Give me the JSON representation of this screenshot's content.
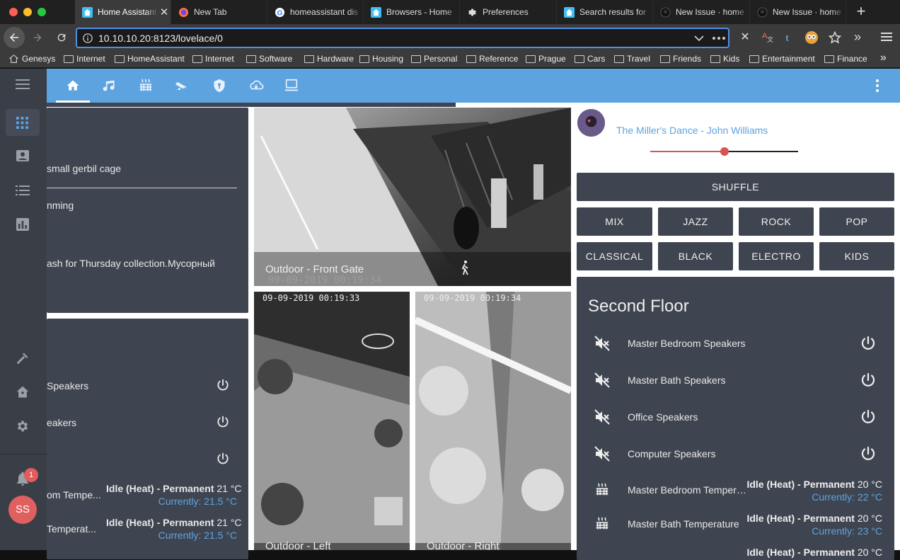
{
  "browser": {
    "tabs": [
      {
        "title": "Home Assistant",
        "icon": "home-assistant-icon",
        "active": true
      },
      {
        "title": "New Tab",
        "icon": "firefox-icon"
      },
      {
        "title": "homeassistant dis",
        "icon": "google-icon"
      },
      {
        "title": "Browsers - Home",
        "icon": "home-assistant-icon"
      },
      {
        "title": "Preferences",
        "icon": "gear-icon"
      },
      {
        "title": "Search results for",
        "icon": "home-assistant-icon"
      },
      {
        "title": "New Issue · home",
        "icon": "github-icon"
      },
      {
        "title": "New Issue · home",
        "icon": "github-icon"
      }
    ],
    "url": "10.10.10.20:8123/lovelace/0",
    "bookmarks": [
      "Genesys",
      "Internet",
      "HomeAssistant",
      "Internet",
      "Software",
      "Hardware",
      "Housing",
      "Personal",
      "Reference",
      "Prague",
      "Cars",
      "Travel",
      "Friends",
      "Kids",
      "Entertainment",
      "Finance"
    ]
  },
  "sidebar": {
    "notification_count": "1",
    "avatar_initials": "SS"
  },
  "left_card1": {
    "items": [
      "small gerbil cage",
      "nming",
      "ash for Thursday collection.Мусорный"
    ]
  },
  "left_card2": {
    "speakers": [
      " Speakers",
      "eakers",
      ""
    ],
    "thermostats": [
      {
        "name": "om Tempe...",
        "state": "Idle (Heat) - Permanent",
        "target": "21 °C",
        "current": "Currently: 21.5 °C"
      },
      {
        "name": " Temperat...",
        "state": "Idle (Heat) - Permanent",
        "target": "21 °C",
        "current": "Currently: 21.5 °C"
      }
    ]
  },
  "cameras": {
    "front": {
      "label": "Outdoor - Front Gate",
      "timestamp": "09-09-2019 00:19:34"
    },
    "left": {
      "label": "Outdoor - Left",
      "timestamp": "09-09-2019 00:19:33"
    },
    "right": {
      "label": "Outdoor - Right",
      "timestamp": "09-09-2019 00:19:34"
    }
  },
  "media": {
    "track": "The Miller's Dance - John Williams",
    "volume": 0.5
  },
  "music_buttons": {
    "shuffle": "SHUFFLE",
    "genres": [
      "MIX",
      "JAZZ",
      "ROCK",
      "POP",
      "CLASSICAL",
      "BLACK",
      "ELECTRO",
      "KIDS"
    ]
  },
  "second_floor": {
    "title": "Second Floor",
    "speakers": [
      "Master Bedroom Speakers",
      "Master Bath Speakers",
      "Office Speakers",
      "Computer Speakers"
    ],
    "thermostats": [
      {
        "name": "Master Bedroom Temperature",
        "state": "Idle (Heat) - Permanent",
        "target": "20 °C",
        "current": "Currently: 22 °C"
      },
      {
        "name": "Master Bath Temperature",
        "state": "Idle (Heat) - Permanent",
        "target": "20 °C",
        "current": "Currently: 23 °C"
      },
      {
        "name": "",
        "state": "Idle (Heat) - Permanent",
        "target": "20 °C",
        "current": ""
      }
    ]
  },
  "colors": {
    "header": "#5da3e0",
    "card": "#3f4550",
    "sidebar": "#3a3f47",
    "accent": "#5da3e0",
    "slider": "#d9534f"
  }
}
